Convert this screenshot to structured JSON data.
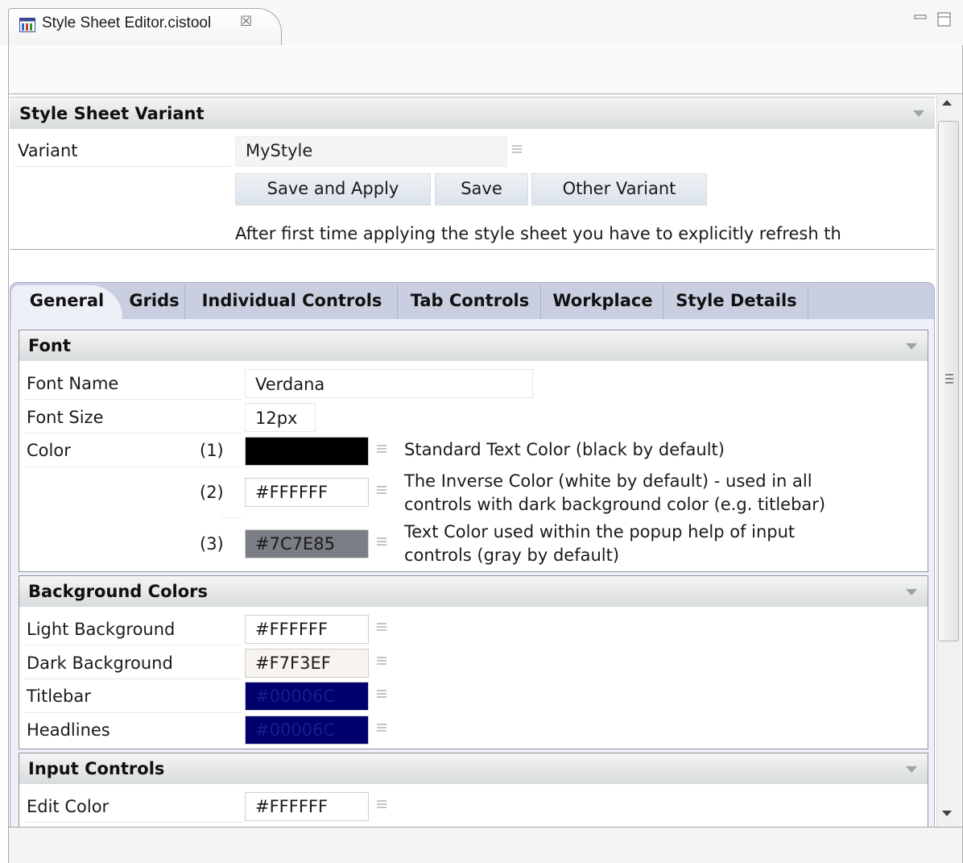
{
  "editor_tab": {
    "title": "Style Sheet Editor.cistool",
    "close_glyph": "☒"
  },
  "window_controls": {
    "minimize": "minimize-icon",
    "maximize": "maximize-icon"
  },
  "variant_section": {
    "title": "Style Sheet Variant",
    "variant_label": "Variant",
    "variant_value": "MyStyle",
    "buttons": {
      "save_and_apply": "Save and Apply",
      "save": "Save",
      "other_variant": "Other Variant"
    },
    "hint": "After first time applying the style sheet you have to explicitly refresh th"
  },
  "tabs": [
    {
      "label": "General",
      "selected": true
    },
    {
      "label": "Grids"
    },
    {
      "label": "Individual Controls"
    },
    {
      "label": "Tab Controls"
    },
    {
      "label": "Workplace"
    },
    {
      "label": "Style Details"
    }
  ],
  "font_group": {
    "title": "Font",
    "font_name_label": "Font Name",
    "font_name_value": "Verdana",
    "font_size_label": "Font Size",
    "font_size_value": "12px",
    "color_label": "Color",
    "colors": [
      {
        "index": "(1)",
        "value": "",
        "swatch": "#000000",
        "text_color": "#ffffff",
        "desc_line1": "Standard Text Color (black by default)",
        "desc_line2": ""
      },
      {
        "index": "(2)",
        "value": "#FFFFFF",
        "swatch": "#ffffff",
        "text_color": "#1a1a1a",
        "desc_line1": "The Inverse Color (white by default) - used in all",
        "desc_line2": "controls with dark background color (e.g. titlebar)"
      },
      {
        "index": "(3)",
        "value": "#7C7E85",
        "swatch": "#7c7e85",
        "text_color": "#1a1a1a",
        "desc_line1": "Text Color used within the popup help of input",
        "desc_line2": "controls (gray by default)"
      }
    ]
  },
  "background_group": {
    "title": "Background Colors",
    "rows": [
      {
        "label": "Light Background",
        "value": "#FFFFFF",
        "swatch": "#ffffff",
        "text_color": "#1a1a1a"
      },
      {
        "label": "Dark Background",
        "value": "#F7F3EF",
        "swatch": "#f7f3ef",
        "text_color": "#1a1a1a"
      },
      {
        "label": "Titlebar",
        "value": "#00006C",
        "swatch": "#00006c",
        "text_color": "#1c1c8a"
      },
      {
        "label": "Headlines",
        "value": "#00006C",
        "swatch": "#00006c",
        "text_color": "#1c1c8a"
      }
    ]
  },
  "input_group": {
    "title": "Input Controls",
    "rows": [
      {
        "label": "Edit Color",
        "value": "#FFFFFF",
        "swatch": "#ffffff",
        "text_color": "#1a1a1a"
      }
    ]
  },
  "colors": {
    "tab_folder": "#c9cfe1",
    "tab_selected": "#eef0f8",
    "button_face": "#e3e8ee",
    "section_header": "#dcdfdf"
  }
}
